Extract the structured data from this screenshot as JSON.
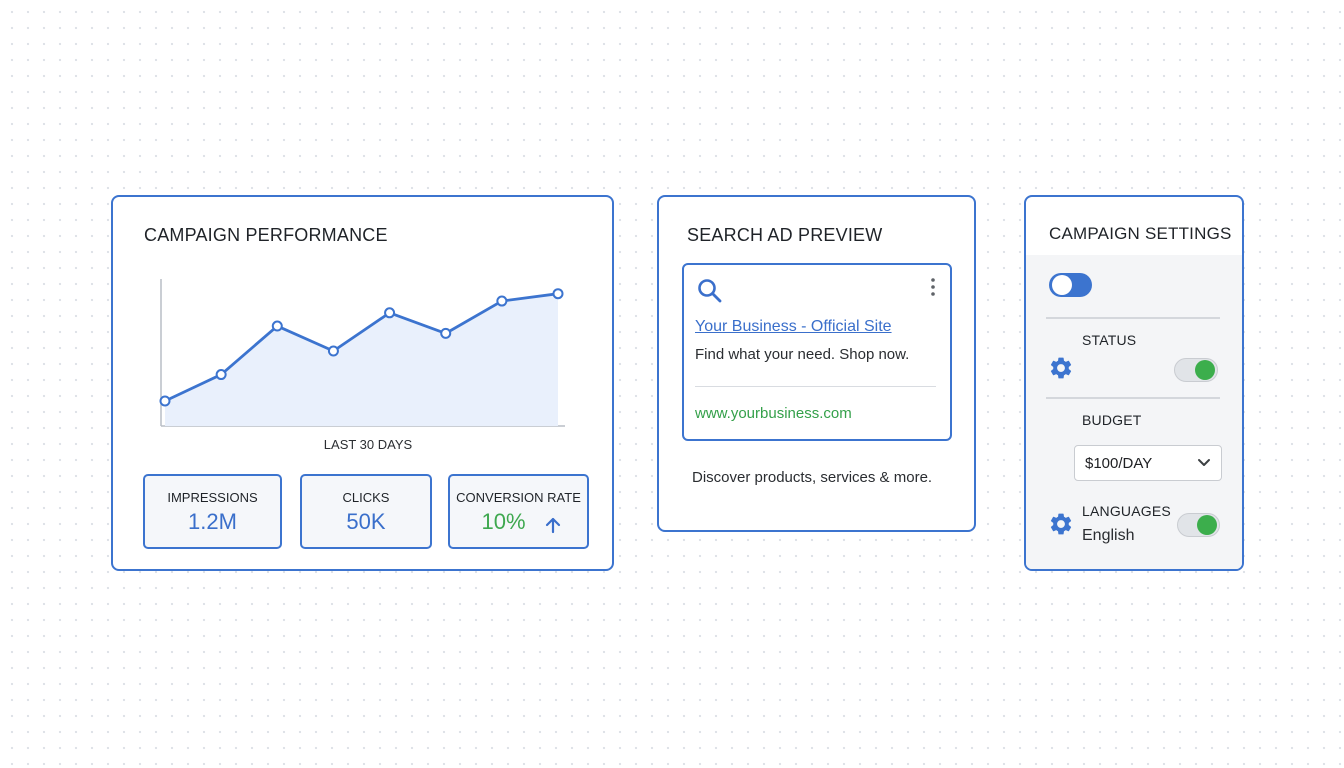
{
  "colors": {
    "primary": "#3c74cf",
    "accent_green": "#3cae4c",
    "chart_fill": "#e9f0fc"
  },
  "performance": {
    "title": "CAMPAIGN PERFORMANCE",
    "x_label": "LAST 30 DAYS",
    "stats": [
      {
        "label": "IMPRESSIONS",
        "value": "1.2M"
      },
      {
        "label": "CLICKS",
        "value": "50K"
      },
      {
        "label": "CONVERSION RATE",
        "value": "10%",
        "trend_icon": "arrow-up-icon"
      }
    ]
  },
  "chart_data": {
    "type": "area",
    "title": "",
    "xlabel": "LAST 30 DAYS",
    "ylabel": "",
    "x": [
      1,
      2,
      3,
      4,
      5,
      6,
      7,
      8
    ],
    "values": [
      17,
      35,
      68,
      51,
      77,
      63,
      85,
      90
    ],
    "ylim": [
      0,
      100
    ],
    "grid": false,
    "markers": true
  },
  "ad_preview": {
    "title": "SEARCH AD PREVIEW",
    "icon": "search-icon",
    "menu_icon": "kebab-menu-icon",
    "headline": "Your Business - Official Site",
    "description": "Find what your need. Shop now.",
    "display_url": "www.yourbusiness.com",
    "footer": "Discover products, services & more."
  },
  "settings": {
    "title": "CAMPAIGN SETTINGS",
    "master_toggle_on": false,
    "status": {
      "label": "STATUS",
      "icon": "gear-icon",
      "toggle_on": true
    },
    "budget": {
      "label": "BUDGET",
      "selected": "$100/DAY"
    },
    "languages": {
      "label": "LANGUAGES",
      "value": "English",
      "icon": "gear-icon",
      "toggle_on": true
    }
  }
}
